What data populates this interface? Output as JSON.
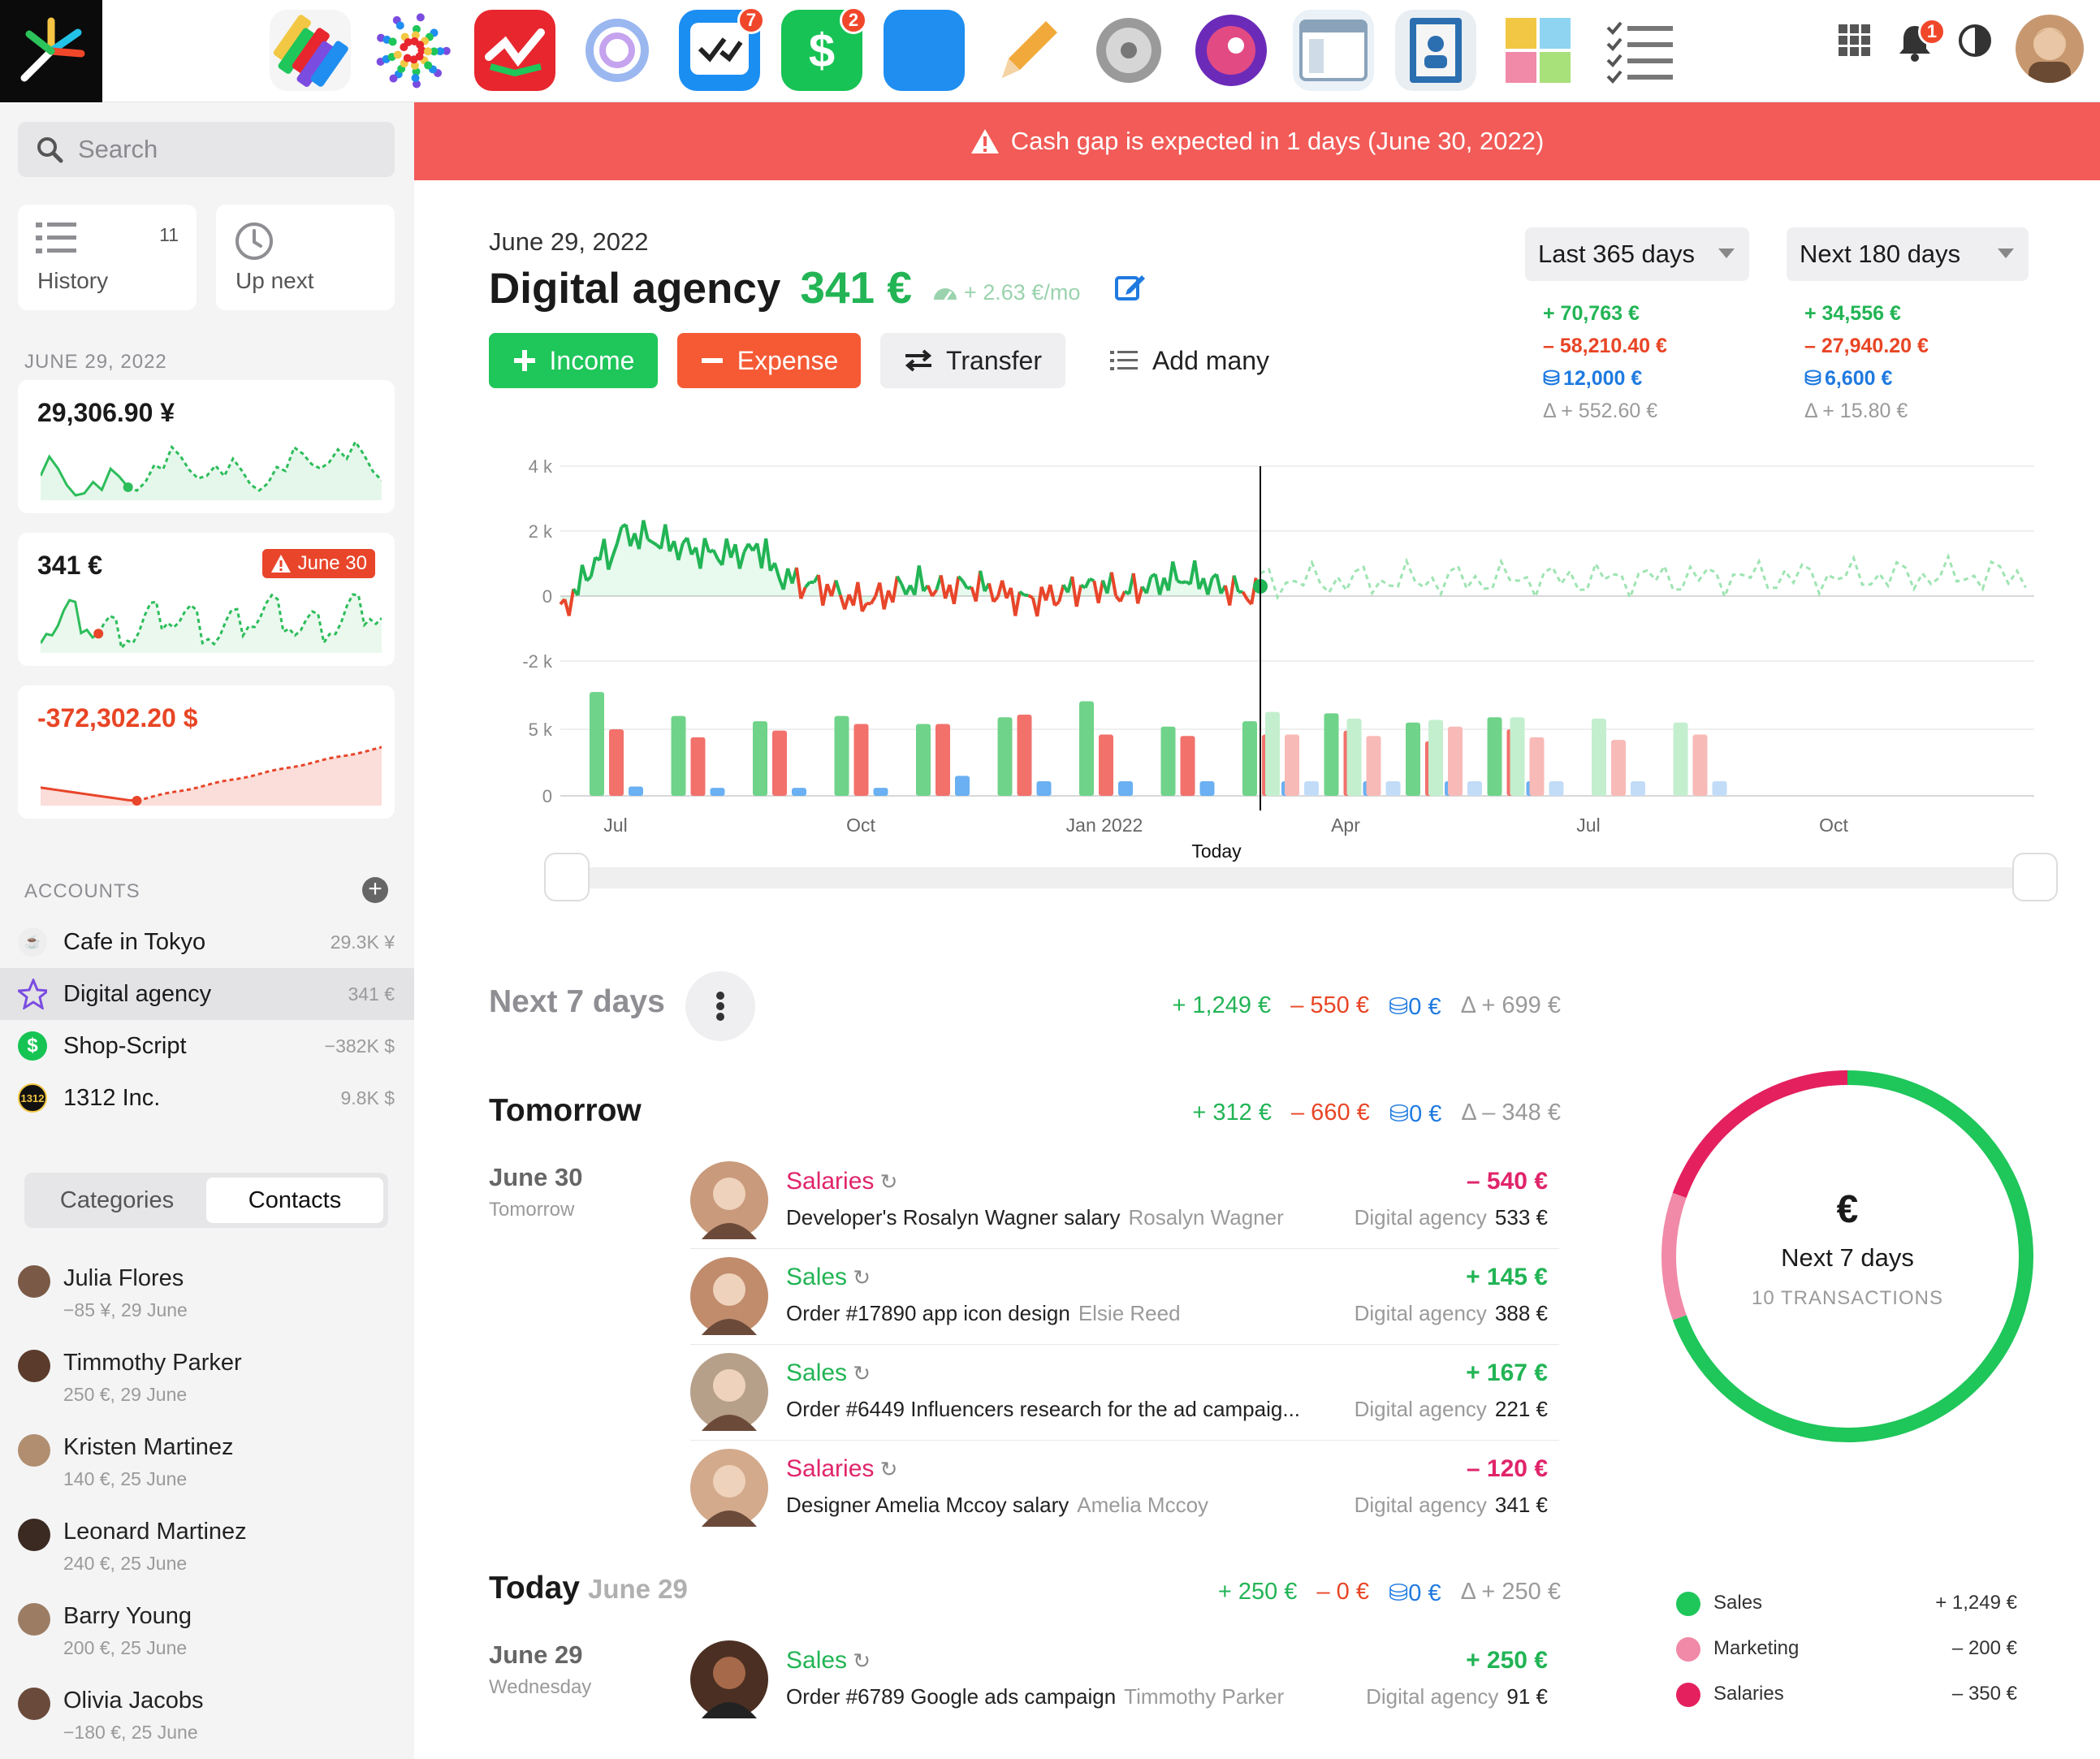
{
  "topbar": {
    "apps": [
      {
        "name": "tasks-app-icon",
        "badge": ""
      },
      {
        "name": "colorful-dots-app-icon",
        "badge": ""
      },
      {
        "name": "finance-chart-app-icon",
        "badge": ""
      },
      {
        "name": "spiral-app-icon",
        "badge": ""
      },
      {
        "name": "checklist-app-icon",
        "badge": "7"
      },
      {
        "name": "money-app-icon",
        "badge": "2"
      },
      {
        "name": "folder-app-icon",
        "badge": ""
      },
      {
        "name": "pencil-app-icon",
        "badge": ""
      },
      {
        "name": "settings-app-icon",
        "badge": ""
      },
      {
        "name": "camera-app-icon",
        "badge": ""
      },
      {
        "name": "window-app-icon",
        "badge": ""
      },
      {
        "name": "contacts-app-icon",
        "badge": ""
      },
      {
        "name": "sticky-notes-app-icon",
        "badge": ""
      },
      {
        "name": "todo-list-app-icon",
        "badge": ""
      }
    ],
    "notifications_badge": "1"
  },
  "sidebar": {
    "search_placeholder": "Search",
    "history_label": "History",
    "history_count": "11",
    "upnext_label": "Up next",
    "date_header": "JUNE 29, 2022",
    "balances": [
      {
        "value": "29,306.90 ¥"
      },
      {
        "value": "341 €",
        "alert": "June 30"
      },
      {
        "value": "-372,302.20 $"
      }
    ],
    "accounts_header": "ACCOUNTS",
    "accounts": [
      {
        "name": "Cafe in Tokyo",
        "value": "29.3K ¥"
      },
      {
        "name": "Digital agency",
        "value": "341 €"
      },
      {
        "name": "Shop-Script",
        "value": "−382K $"
      },
      {
        "name": "1312 Inc.",
        "value": "9.8K $",
        "icon_text": "1312"
      }
    ],
    "tabs": [
      "Categories",
      "Contacts"
    ],
    "contacts": [
      {
        "name": "Julia Flores",
        "sub": "−85 ¥, 29 June"
      },
      {
        "name": "Timmothy Parker",
        "sub": "250 €, 29 June"
      },
      {
        "name": "Kristen Martinez",
        "sub": "140 €, 25 June"
      },
      {
        "name": "Leonard Martinez",
        "sub": "240 €, 25 June"
      },
      {
        "name": "Barry Young",
        "sub": "200 €, 25 June"
      },
      {
        "name": "Olivia Jacobs",
        "sub": "−180 €, 25 June"
      }
    ]
  },
  "banner": {
    "text": "Cash gap is expected in 1 days (June 30, 2022)"
  },
  "header": {
    "date": "June 29, 2022",
    "title": "Digital agency",
    "balance": "341 €",
    "rate": "+ 2.63 €/mo"
  },
  "actions": {
    "income": "Income",
    "expense": "Expense",
    "transfer": "Transfer",
    "add_many": "Add many"
  },
  "periods": [
    {
      "label": "Last 365 days",
      "income": "+ 70,763 €",
      "expense": "– 58,210.40 €",
      "transfer": "12,000 €",
      "delta": "Δ + 552.60 €"
    },
    {
      "label": "Next 180 days",
      "income": "+ 34,556 €",
      "expense": "– 27,940.20 €",
      "transfer": "6,600 €",
      "delta": "Δ + 15.80 €"
    }
  ],
  "chart_data": {
    "type": "line",
    "line_yticks": [
      "4 k",
      "2 k",
      "0",
      "-2 k"
    ],
    "bar_yticks": [
      "5 k",
      "0"
    ],
    "xticks": [
      "Jul",
      "Oct",
      "Jan 2022",
      "Apr",
      "Jul",
      "Oct"
    ],
    "today_label": "Today",
    "bars_past": [
      {
        "income": 7800,
        "expense": 5000,
        "transfer": 700
      },
      {
        "income": 6000,
        "expense": 4400,
        "transfer": 600
      },
      {
        "income": 5600,
        "expense": 4900,
        "transfer": 600
      },
      {
        "income": 6000,
        "expense": 5400,
        "transfer": 600
      },
      {
        "income": 5400,
        "expense": 5400,
        "transfer": 1500
      },
      {
        "income": 5900,
        "expense": 6100,
        "transfer": 1100
      },
      {
        "income": 7100,
        "expense": 4600,
        "transfer": 1100
      },
      {
        "income": 5200,
        "expense": 4500,
        "transfer": 1100
      },
      {
        "income": 5600,
        "expense": 4600,
        "transfer": 1100
      },
      {
        "income": 6200,
        "expense": 4900,
        "transfer": 1100
      },
      {
        "income": 5500,
        "expense": 4100,
        "transfer": 1100
      },
      {
        "income": 5900,
        "expense": 5000,
        "transfer": 1100
      }
    ],
    "bars_future": [
      {
        "income": 6300,
        "expense": 4600,
        "transfer": 1100
      },
      {
        "income": 5800,
        "expense": 4500,
        "transfer": 1100
      },
      {
        "income": 5700,
        "expense": 5200,
        "transfer": 1100
      },
      {
        "income": 5900,
        "expense": 4400,
        "transfer": 1100
      },
      {
        "income": 5800,
        "expense": 4200,
        "transfer": 1100
      },
      {
        "income": 5500,
        "expense": 4600,
        "transfer": 1100
      }
    ]
  },
  "next7": {
    "title": "Next 7 days",
    "income": "+ 1,249 €",
    "expense": "– 550 €",
    "transfer": "0 €",
    "delta": "Δ + 699 €"
  },
  "tomorrow": {
    "title": "Tomorrow",
    "income": "+ 312 €",
    "expense": "– 660 €",
    "transfer": "0 €",
    "delta": "Δ – 348 €",
    "date": "June 30",
    "sub": "Tomorrow"
  },
  "today": {
    "title": "Today",
    "title_date": "June 29",
    "income": "+ 250 €",
    "expense": "– 0 €",
    "transfer": "0 €",
    "delta": "Δ + 250 €",
    "date": "June 29",
    "sub": "Wednesday"
  },
  "transactions": [
    {
      "category": "Salaries",
      "desc": "Developer's Rosalyn Wagner salary",
      "contact": "Rosalyn Wagner",
      "amount": "– 540 €",
      "account": "Digital agency",
      "balance": "533 €"
    },
    {
      "category": "Sales",
      "desc": "Order #17890 app icon design",
      "contact": "Elsie Reed",
      "amount": "+ 145 €",
      "account": "Digital agency",
      "balance": "388 €"
    },
    {
      "category": "Sales",
      "desc": "Order #6449 Influencers research for the ad campaig...",
      "contact": "",
      "amount": "+ 167 €",
      "account": "Digital agency",
      "balance": "221 €"
    },
    {
      "category": "Salaries",
      "desc": "Designer Amelia Mccoy salary",
      "contact": "Amelia Mccoy",
      "amount": "– 120 €",
      "account": "Digital agency",
      "balance": "341 €"
    },
    {
      "category": "Sales",
      "desc": "Order #6789 Google ads campaign",
      "contact": "Timmothy Parker",
      "amount": "+ 250 €",
      "account": "Digital agency",
      "balance": "91 €"
    }
  ],
  "donut": {
    "symbol": "€",
    "title": "Next 7 days",
    "sub": "10 TRANSACTIONS",
    "segments": [
      {
        "name": "Sales",
        "value": 1249,
        "color": "#1fc65a"
      },
      {
        "name": "Marketing",
        "value": 200,
        "color": "#f08aa8"
      },
      {
        "name": "Salaries",
        "value": 350,
        "color": "#e4205f"
      }
    ],
    "legend": [
      {
        "name": "Sales",
        "value": "+ 1,249 €"
      },
      {
        "name": "Marketing",
        "value": "– 200 €"
      },
      {
        "name": "Salaries",
        "value": "– 350 €"
      }
    ]
  }
}
